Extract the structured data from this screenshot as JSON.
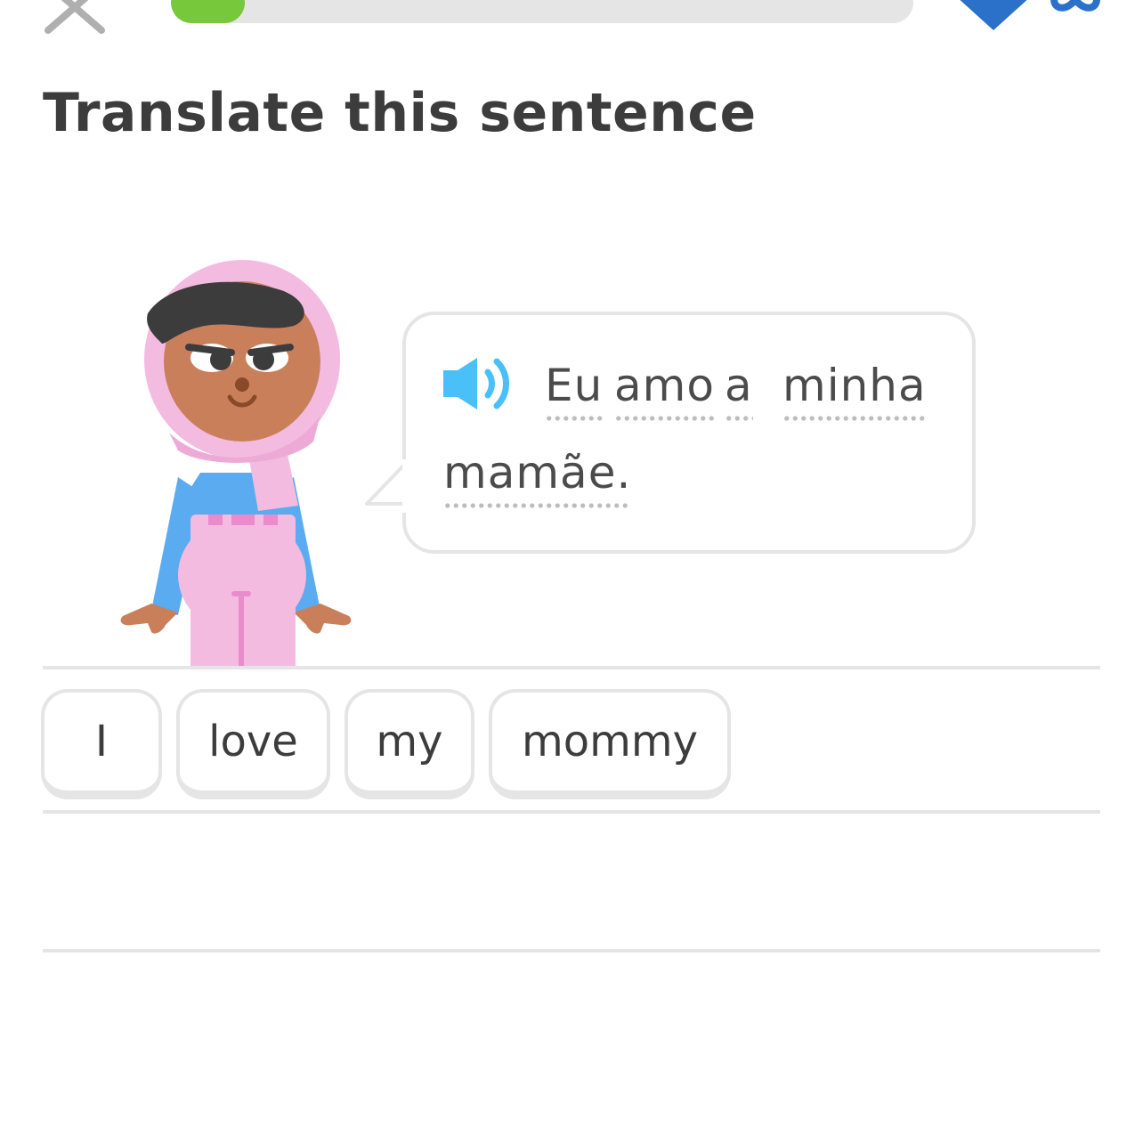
{
  "header": {
    "close_icon": "close-icon",
    "progress": 0.1,
    "hearts_icon": "heart-icon",
    "infinity_icon": "infinity-icon",
    "colors": {
      "progress": "#78c83c",
      "track": "#e5e5e5",
      "hearts": "#2b70c9"
    }
  },
  "title": "Translate this sentence",
  "prompt": {
    "speaker_icon": "speaker-icon",
    "words": [
      "Eu",
      "amo",
      "a",
      "minha",
      "mamãe."
    ]
  },
  "answer_tiles": [
    "I",
    "love",
    "my",
    "mommy"
  ],
  "colors": {
    "text": "#3c3c3c",
    "border": "#e5e5e5",
    "speaker": "#49c0f8"
  }
}
